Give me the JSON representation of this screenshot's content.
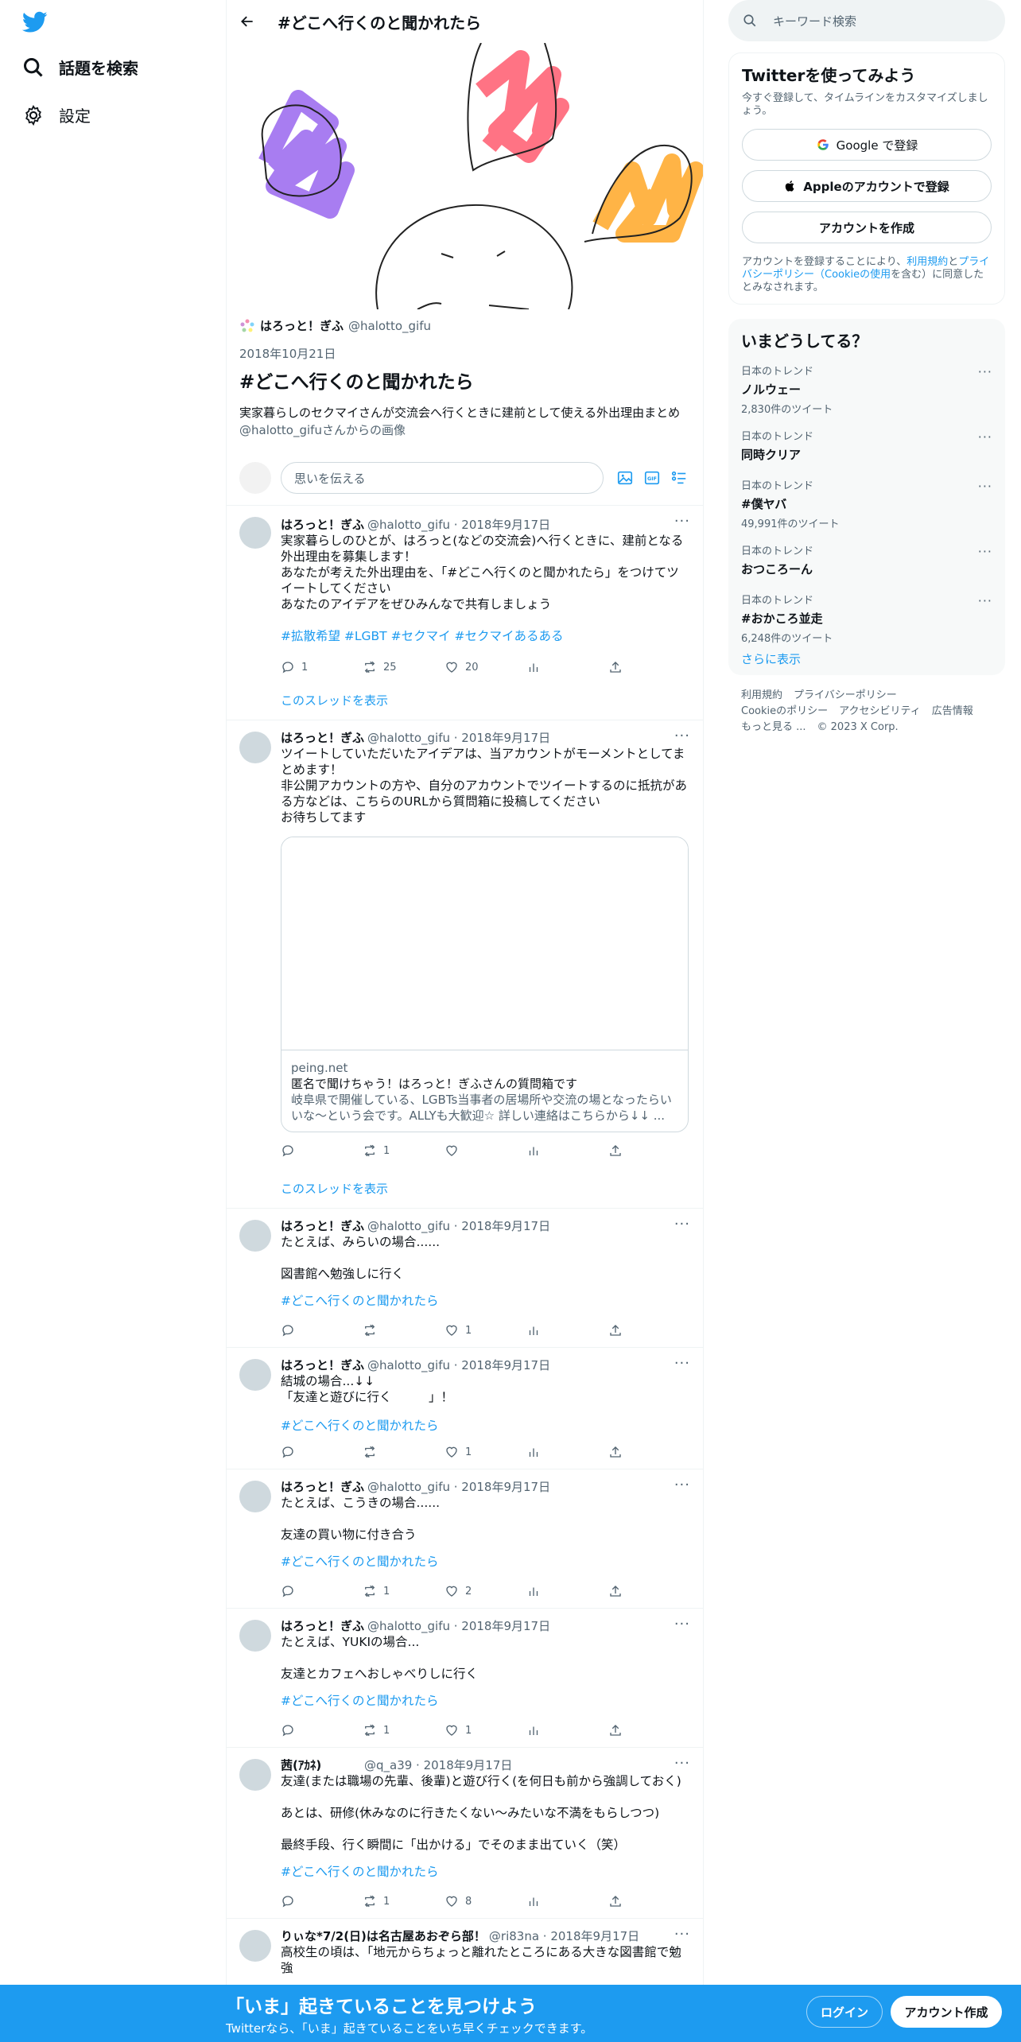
{
  "nav": {
    "explore": "話題を検索",
    "settings": "設定"
  },
  "header": {
    "title": "#どこへ行くのと聞かれたら"
  },
  "moment": {
    "author_name": "はろっと！ぎふ",
    "author_handle": "@halotto_gifu",
    "date": "2018年10月21日",
    "title": "#どこへ行くのと聞かれたら",
    "description": "実家暮らしのセクマイさんが交流会へ行くときに建前として使える外出理由まとめ",
    "credit": "@halotto_gifuさんからの画像"
  },
  "compose": {
    "placeholder": "思いを伝える"
  },
  "tweets": [
    {
      "name": "はろっと！ぎふ",
      "handle": "@halotto_gifu · 2018年9月17日",
      "body": "実家暮らしのひとが、はろっと(などの交流会)へ行くときに、建前となる外出理由を募集します！\nあなたが考えた外出理由を、「#どこへ行くのと聞かれたら」をつけてツイートしてください\nあなたのアイデアをぜひみんなで共有しましょう",
      "tags": "#拡散希望 #LGBT #セクマイ #セクマイあるある",
      "reply": "1",
      "retweet": "25",
      "like": "20",
      "thread": "このスレッドを表示"
    },
    {
      "name": "はろっと！ぎふ",
      "handle": "@halotto_gifu · 2018年9月17日",
      "body": "ツイートしていただいたアイデアは、当アカウントがモーメントとしてまとめます！\n非公開アカウントの方や、自分のアカウントでツイートするのに抵抗がある方などは、こちらのURLから質問箱に投稿してください\nお待ちしてます",
      "card_domain": "peing.net",
      "card_title": "匿名で聞けちゃう！はろっと！ぎふさんの質問箱です",
      "card_desc": "岐阜県で開催している、LGBTs当事者の居場所や交流の場となったらいいな〜という会です。ALLYも大歓迎☆ 詳しい連絡はこちらから↓↓ ...",
      "reply": "",
      "retweet": "1",
      "like": "",
      "thread": "このスレッドを表示"
    },
    {
      "name": "はろっと！ぎふ",
      "handle": "@halotto_gifu · 2018年9月17日",
      "body": "たとえば、みらいの場合......\n\n図書館へ勉強しに行く",
      "tags": "#どこへ行くのと聞かれたら",
      "reply": "",
      "retweet": "",
      "like": "1"
    },
    {
      "name": "はろっと！ぎふ",
      "handle": "@halotto_gifu · 2018年9月17日",
      "body": "結城の場合...↓↓\n「友達と遊びに行く　　　」！",
      "tags": " #どこへ行くのと聞かれたら",
      "reply": "",
      "retweet": "",
      "like": "1"
    },
    {
      "name": "はろっと！ぎふ",
      "handle": "@halotto_gifu · 2018年9月17日",
      "body": "たとえば、こうきの場合......\n\n友達の買い物に付き合う",
      "tags": "#どこへ行くのと聞かれたら",
      "reply": "",
      "retweet": "1",
      "like": "2"
    },
    {
      "name": "はろっと！ぎふ",
      "handle": "@halotto_gifu · 2018年9月17日",
      "body": "たとえば、YUKIの場合...\n\n友達とカフェへおしゃべりしに行く",
      "tags": "#どこへ行くのと聞かれたら",
      "reply": "",
      "retweet": "1",
      "like": "1"
    },
    {
      "name": "茜(ｱｶﾈ)",
      "handle": "　　　 @q_a39 · 2018年9月17日",
      "body": "友達(または職場の先輩、後輩)と遊び行く(を何日も前から強調しておく)\n\nあとは、研修(休みなのに行きたくない〜みたいな不満をもらしつつ)\n\n最終手段、行く瞬間に「出かける」でそのまま出ていく（笑）",
      "tags": " #どこへ行くのと聞かれたら",
      "reply": "",
      "retweet": "1",
      "like": "8"
    },
    {
      "name": "りぃな*7/2(日)は名古屋あおぞら部！",
      "handle": "@ri83na · 2018年9月17日",
      "body": "高校生の頃は、「地元からちょっと離れたところにある大きな図書館で勉強"
    }
  ],
  "sidebar": {
    "search_placeholder": "キーワード検索",
    "signup_title": "Twitterを使ってみよう",
    "signup_sub": "今すぐ登録して、タイムラインをカスタマイズしましょう。",
    "google_btn": "Google で登録",
    "apple_btn": "Appleのアカウントで登録",
    "create_btn": "アカウントを作成",
    "legal_a": "アカウントを登録することにより、",
    "legal_terms": "利用規約",
    "legal_b": "と",
    "legal_privacy": "プライバシーポリシー（Cookieの使用",
    "legal_c": "を含む）に同意したとみなされます。",
    "trends_title": "いまどうしてる？",
    "trends": [
      {
        "cat": "日本のトレンド",
        "name": "ノルウェー",
        "count": "2,830件のツイート"
      },
      {
        "cat": "日本のトレンド",
        "name": "同時クリア",
        "count": ""
      },
      {
        "cat": "日本のトレンド",
        "name": "#僕ヤバ",
        "count": "49,991件のツイート"
      },
      {
        "cat": "日本のトレンド",
        "name": "おつころーん",
        "count": ""
      },
      {
        "cat": "日本のトレンド",
        "name": "#おかころ並走",
        "count": "6,248件のツイート"
      }
    ],
    "show_more": "さらに表示",
    "footer": [
      "利用規約",
      "プライバシーポリシー",
      "Cookieのポリシー",
      "アクセシビリティ",
      "広告情報",
      "もっと見る ...",
      "© 2023 X Corp."
    ]
  },
  "bottom": {
    "headline": "「いま」起きていることを見つけよう",
    "sub": "Twitterなら、「いま」起きていることをいち早くチェックできます。",
    "login": "ログイン",
    "signup": "アカウント作成"
  },
  "colors": {
    "accent": "#1d9bf0",
    "muted": "#536471"
  }
}
